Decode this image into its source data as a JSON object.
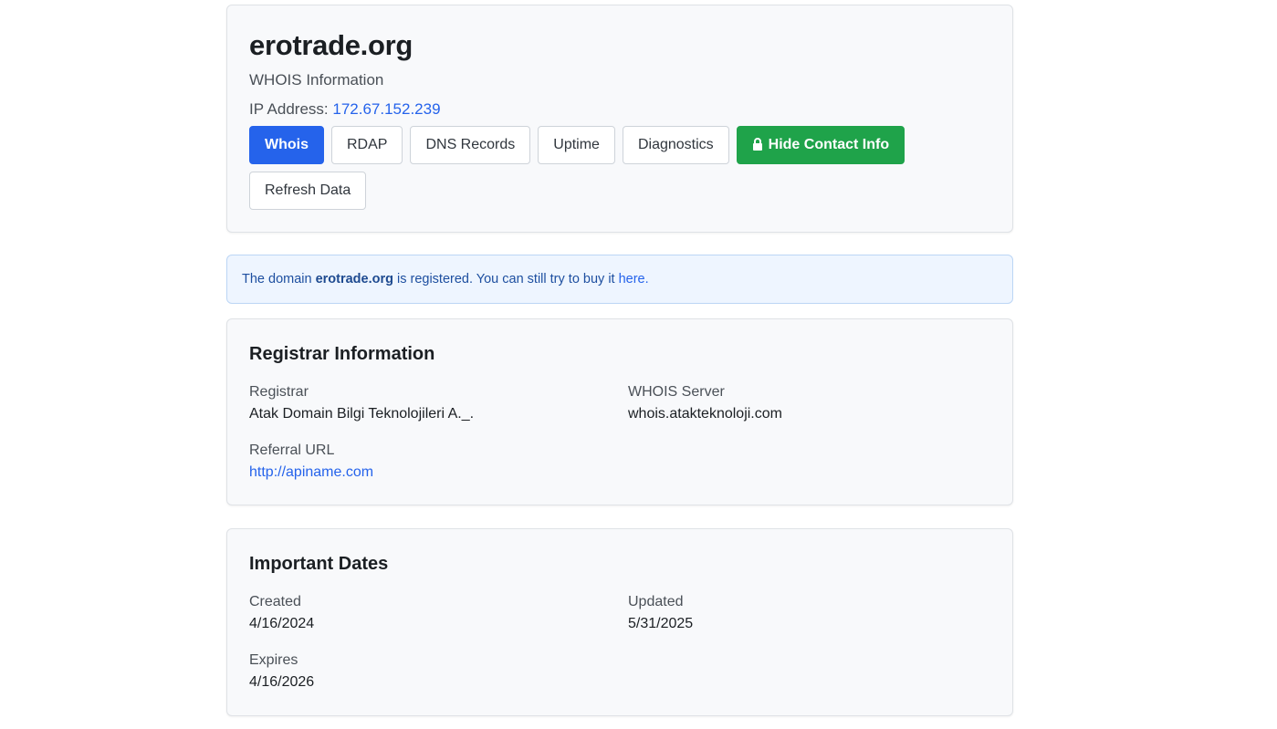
{
  "header": {
    "domain": "erotrade.org",
    "subtitle": "WHOIS Information",
    "ip_label": "IP Address:",
    "ip_value": "172.67.152.239",
    "buttons": {
      "whois": "Whois",
      "rdap": "RDAP",
      "dns": "DNS Records",
      "uptime": "Uptime",
      "diagnostics": "Diagnostics",
      "hide_contact": "Hide Contact Info",
      "refresh": "Refresh Data"
    }
  },
  "alert": {
    "prefix": "The domain",
    "domain": "erotrade.org",
    "middle": "is registered. You can still try to buy it",
    "link": "here."
  },
  "registrar": {
    "title": "Registrar Information",
    "registrar_label": "Registrar",
    "registrar_value": "Atak Domain Bilgi Teknolojileri A._.",
    "whois_server_label": "WHOIS Server",
    "whois_server_value": "whois.atakteknoloji.com",
    "referral_label": "Referral URL",
    "referral_value": "http://apiname.com"
  },
  "dates": {
    "title": "Important Dates",
    "created_label": "Created",
    "created_value": "4/16/2024",
    "updated_label": "Updated",
    "updated_value": "5/31/2025",
    "expires_label": "Expires",
    "expires_value": "4/16/2026"
  },
  "colors": {
    "primary": "#2563eb",
    "success": "#1fa34a",
    "alert_bg": "#eef5ff"
  },
  "icons": {
    "hide_contact": "lock-icon"
  }
}
